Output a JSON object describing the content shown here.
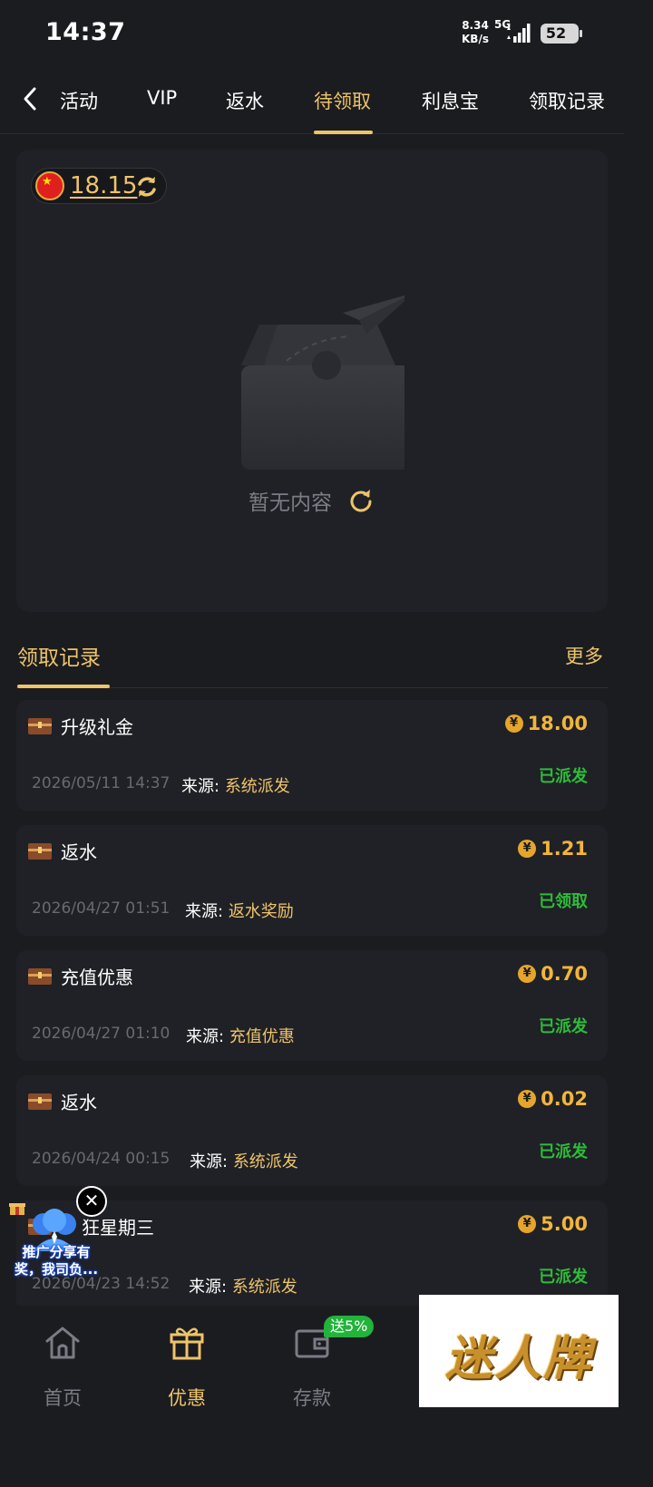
{
  "status_bar": {
    "time": "14:37",
    "net_speed_value": "8.34",
    "net_speed_unit": "KB/s",
    "network": "5G",
    "battery": "52"
  },
  "tabs": [
    {
      "label": "活动"
    },
    {
      "label": "VIP"
    },
    {
      "label": "返水"
    },
    {
      "label": "待领取",
      "active": true
    },
    {
      "label": "利息宝"
    },
    {
      "label": "领取记录"
    }
  ],
  "pending": {
    "balance": "18.15",
    "empty_text": "暂无内容"
  },
  "records": {
    "title": "领取记录",
    "more_label": "更多",
    "source_prefix": "来源:",
    "items": [
      {
        "title": "升级礼金",
        "amount": "18.00",
        "time": "2026/05/11 14:37",
        "source": "系统派发",
        "status": "已派发"
      },
      {
        "title": "返水",
        "amount": "1.21",
        "time": "2026/04/27 01:51",
        "source": "返水奖励",
        "status": "已领取"
      },
      {
        "title": "充值优惠",
        "amount": "0.70",
        "time": "2026/04/27 01:10",
        "source": "充值优惠",
        "status": "已派发"
      },
      {
        "title": "返水",
        "amount": "0.02",
        "time": "2026/04/24 00:15",
        "source": "系统派发",
        "status": "已派发"
      },
      {
        "title": "狂星期三",
        "amount": "5.00",
        "time": "2026/04/23 14:52",
        "source": "系统派发",
        "status": "已派发"
      }
    ]
  },
  "bottom_nav": {
    "items": [
      {
        "label": "首页",
        "icon": "home-icon"
      },
      {
        "label": "优惠",
        "icon": "gift-icon",
        "active": true
      },
      {
        "label": "存款",
        "icon": "wallet-icon"
      }
    ],
    "deposit_badge": "送5%"
  },
  "promo": {
    "line1": "推广分享有",
    "line2": "奖，我司负..."
  },
  "watermark": "迷人牌",
  "colors": {
    "background": "#1b1c20",
    "card": "#202126",
    "accent_gold": "#eec46a",
    "amount_orange": "#f2b53a",
    "status_green": "#2dbd3a",
    "muted_text": "#7a7d85"
  }
}
